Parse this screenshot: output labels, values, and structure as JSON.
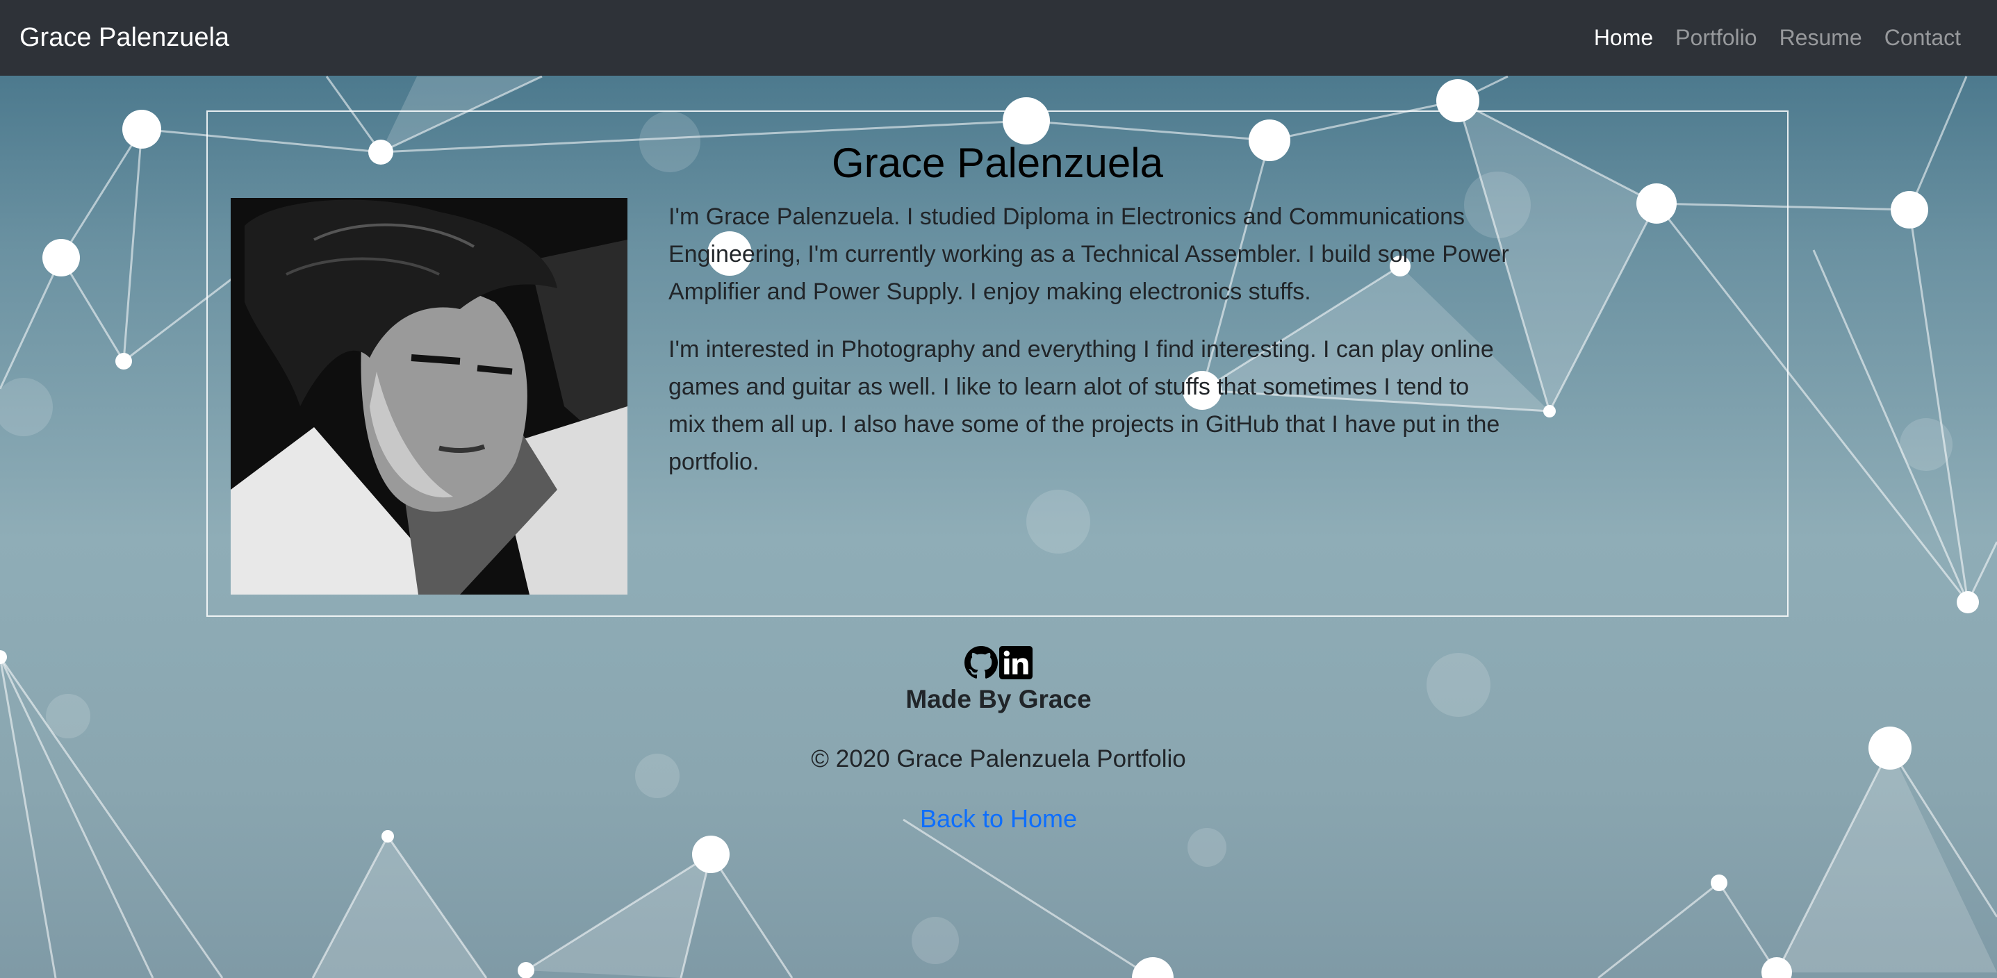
{
  "navbar": {
    "brand": "Grace Palenzuela",
    "links": [
      {
        "label": "Home",
        "active": true
      },
      {
        "label": "Portfolio",
        "active": false
      },
      {
        "label": "Resume",
        "active": false
      },
      {
        "label": "Contact",
        "active": false
      }
    ]
  },
  "about": {
    "heading": "Grace Palenzuela",
    "paragraphs": [
      "I'm Grace Palenzuela. I studied Diploma in Electronics and Communications Engineering, I'm currently working as a Technical Assembler. I build some Power Amplifier and Power Supply. I enjoy making electronics stuffs.",
      "I'm interested in Photography and everything I find interesting. I can play online games and guitar as well. I like to learn alot of stuffs that sometimes I tend to mix them all up. I also have some of the projects in GitHub that I have put in the portfolio."
    ]
  },
  "footer": {
    "icons": [
      "github-icon",
      "linkedin-icon"
    ],
    "made_by": "Made By Grace",
    "copyright": "© 2020 Grace Palenzuela Portfolio",
    "back_link": "Back to Home"
  },
  "colors": {
    "navbar_bg": "#2e3238",
    "link_blue": "#0d6efd",
    "text_dark": "#212529"
  }
}
